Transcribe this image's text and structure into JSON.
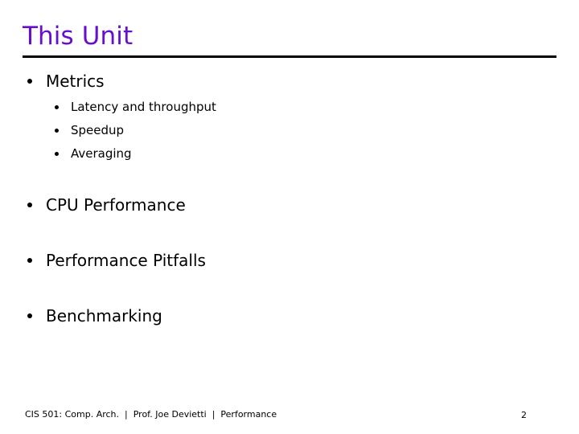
{
  "slide": {
    "title": "This Unit",
    "title_color": "#6610cc",
    "rule_color": "#000000",
    "background": "#ffffff",
    "text_color": "#000000"
  },
  "outline": {
    "items": [
      {
        "label": "Metrics",
        "children": [
          {
            "label": "Latency and throughput"
          },
          {
            "label": "Speedup"
          },
          {
            "label": "Averaging"
          }
        ]
      },
      {
        "label": "CPU Performance",
        "children": []
      },
      {
        "label": "Performance Pitfalls",
        "children": []
      },
      {
        "label": "Benchmarking",
        "children": []
      }
    ]
  },
  "footer": {
    "text": "CIS 501: Comp. Arch.  |  Prof. Joe Devietti  |  Performance",
    "course": "CIS 501: Comp. Arch.",
    "instructor": "Prof. Joe Devietti",
    "topic": "Performance",
    "separator": "|",
    "page_number": "2"
  }
}
